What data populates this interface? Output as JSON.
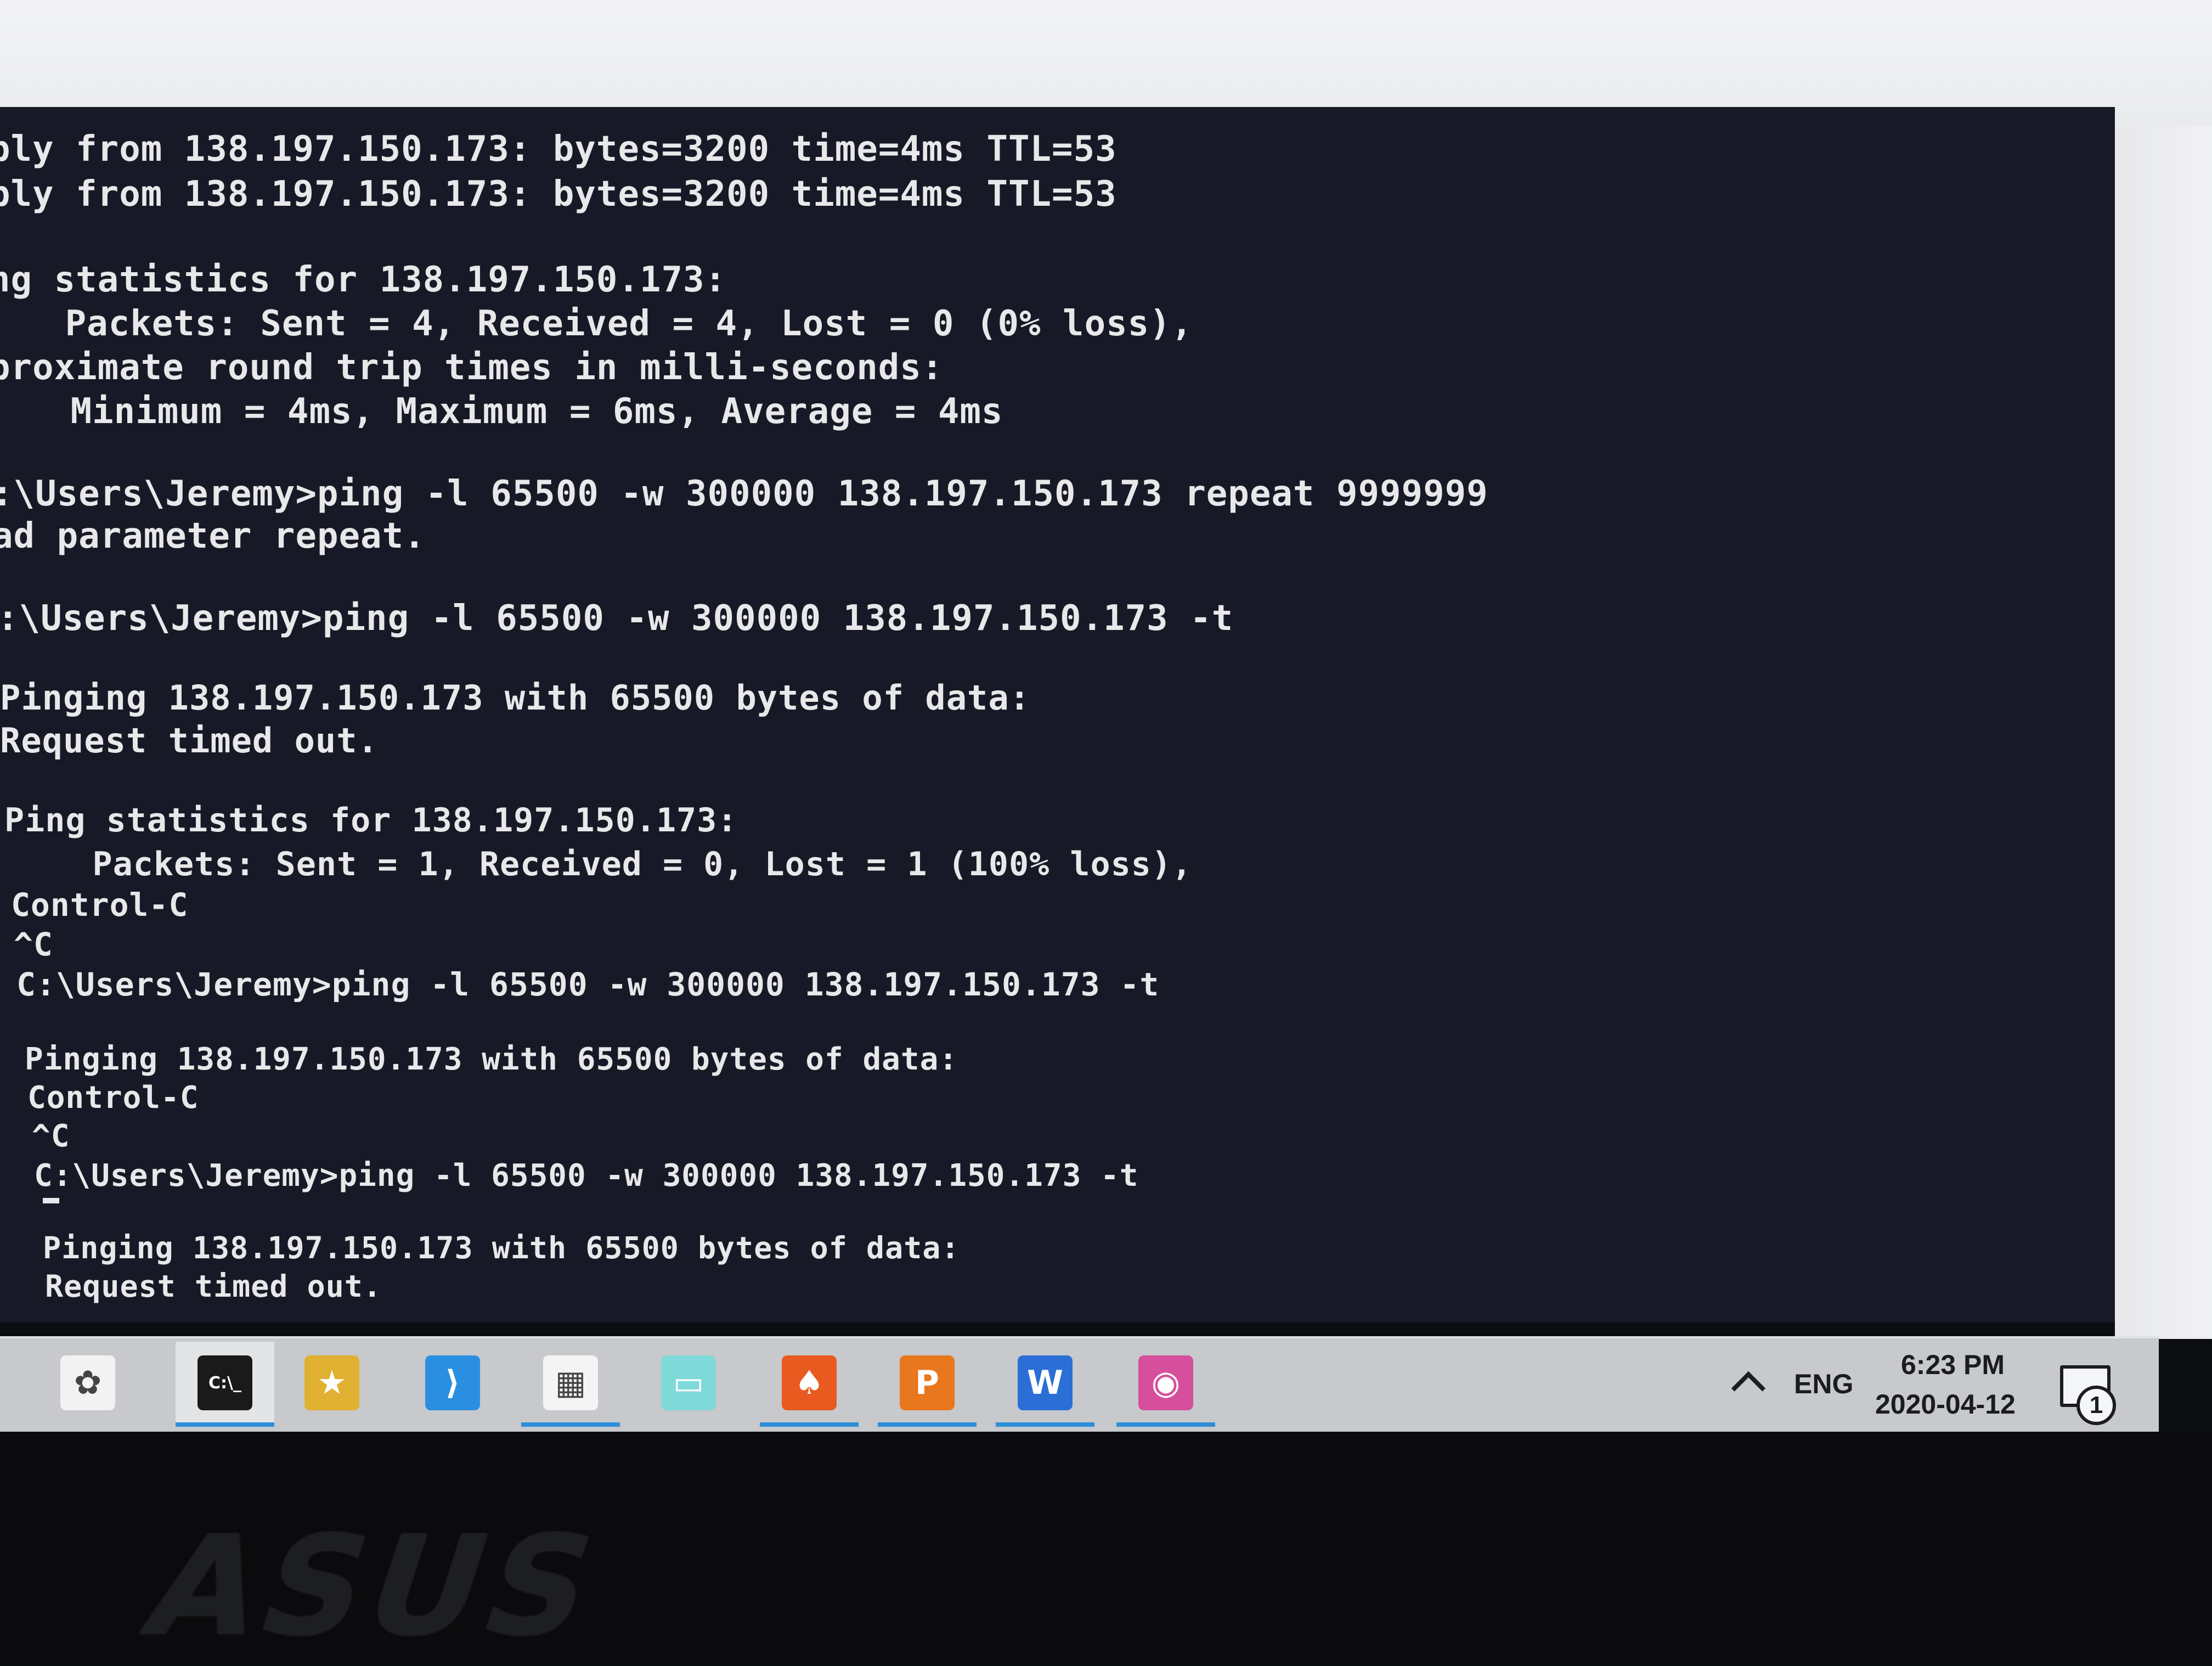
{
  "console": {
    "lines": [
      "ply from 138.197.150.173: bytes=3200 time=4ms TTL=53",
      "ply from 138.197.150.173: bytes=3200 time=4ms TTL=53",
      "",
      "ng statistics for 138.197.150.173:",
      "   Packets: Sent = 4, Received = 4, Lost = 0 (0% loss),",
      "proximate round trip times in milli-seconds:",
      "   Minimum = 4ms, Maximum = 6ms, Average = 4ms",
      "",
      ":\\Users\\Jeremy>ping -l 65500 -w 300000 138.197.150.173 repeat 9999999",
      "ad parameter repeat.",
      "",
      ":\\Users\\Jeremy>ping -l 65500 -w 300000 138.197.150.173 -t",
      "",
      "Pinging 138.197.150.173 with 65500 bytes of data:",
      "Request timed out.",
      "",
      "Ping statistics for 138.197.150.173:",
      "    Packets: Sent = 1, Received = 0, Lost = 1 (100% loss),",
      "Control-C",
      "^C",
      "C:\\Users\\Jeremy>ping -l 65500 -w 300000 138.197.150.173 -t",
      "",
      "Pinging 138.197.150.173 with 65500 bytes of data:",
      "Control-C",
      "^C",
      "C:\\Users\\Jeremy>ping -l 65500 -w 300000 138.197.150.173 -t",
      "",
      "Pinging 138.197.150.173 with 65500 bytes of data:",
      "Request timed out."
    ]
  },
  "taskbar": {
    "icons": [
      {
        "name": "pinned-app-icon",
        "glyph": "✿",
        "color": "#f2f2f2"
      },
      {
        "name": "command-prompt-icon",
        "glyph": "C:\\_",
        "color": "#1a1a1a"
      },
      {
        "name": "anime-app-icon",
        "glyph": "★",
        "color": "#e0b030"
      },
      {
        "name": "visual-studio-code-icon",
        "glyph": "⟩",
        "color": "#2a8fe0"
      },
      {
        "name": "calculator-icon",
        "glyph": "▦",
        "color": "#f4f4f4"
      },
      {
        "name": "chat-app-icon",
        "glyph": "▭",
        "color": "#7fd9d9"
      },
      {
        "name": "poker-app-icon",
        "glyph": "♠",
        "color": "#e85a20"
      },
      {
        "name": "powerpoint-icon",
        "glyph": "P",
        "color": "#e8771e"
      },
      {
        "name": "word-icon",
        "glyph": "W",
        "color": "#2b6fd6"
      },
      {
        "name": "wireless-app-icon",
        "glyph": "◉",
        "color": "#d64f9c"
      }
    ],
    "tray": {
      "language": "ENG",
      "time": "6:23 PM",
      "date": "2020-04-12",
      "notification_count": "1"
    }
  },
  "monitor": {
    "brand": "ASUS"
  }
}
